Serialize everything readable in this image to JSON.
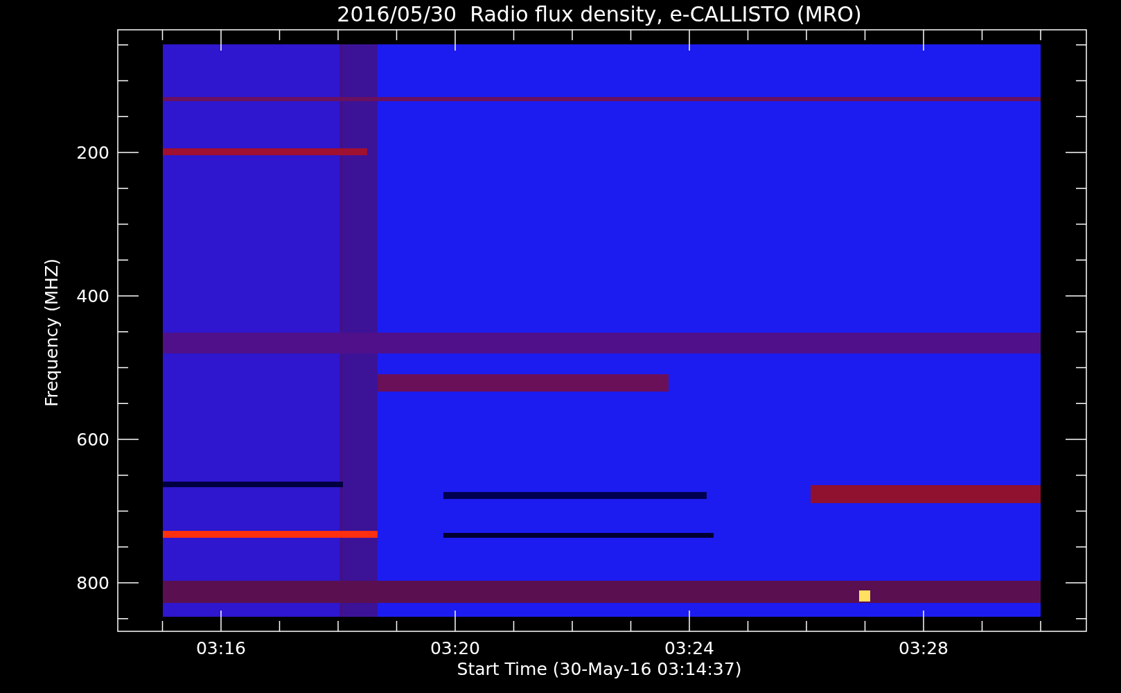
{
  "chart": {
    "title": "2016/05/30  Radio flux density, e-CALLISTO (MRO)",
    "ylabel": "Frequency (MHZ)",
    "xlabel": "Start Time (30-May-16 03:14:37)",
    "yticks": [
      "200",
      "400",
      "600",
      "800"
    ],
    "xticks": [
      "03:16",
      "03:20",
      "03:24",
      "03:28"
    ]
  }
}
